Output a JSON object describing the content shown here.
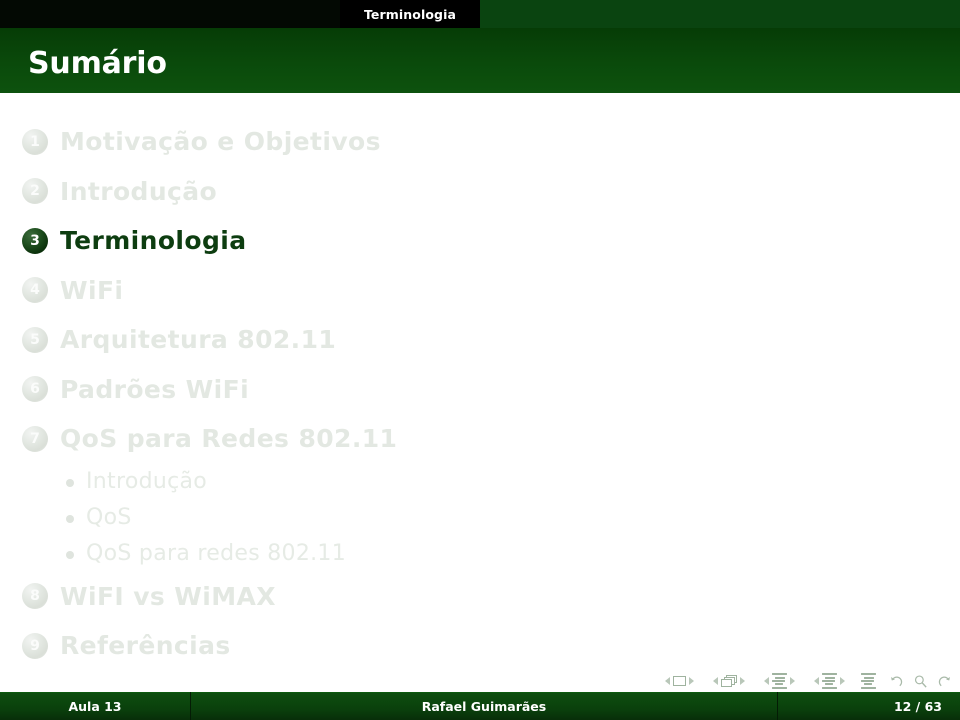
{
  "header": {
    "sections": [
      {
        "label": "",
        "active": false
      },
      {
        "label": "",
        "active": false
      },
      {
        "label": "Terminologia",
        "active": true
      },
      {
        "label": "",
        "active": false
      }
    ],
    "current_section": "Terminologia"
  },
  "title": {
    "text": "Sumário"
  },
  "toc": {
    "sections": [
      {
        "number": "1",
        "label": "Motivação e Objetivos",
        "active": false,
        "subitems": []
      },
      {
        "number": "2",
        "label": "Introdução",
        "active": false,
        "subitems": []
      },
      {
        "number": "3",
        "label": "Terminologia",
        "active": true,
        "subitems": []
      },
      {
        "number": "4",
        "label": "WiFi",
        "active": false,
        "subitems": []
      },
      {
        "number": "5",
        "label": "Arquitetura 802.11",
        "active": false,
        "subitems": []
      },
      {
        "number": "6",
        "label": "Padrões WiFi",
        "active": false,
        "subitems": []
      },
      {
        "number": "7",
        "label": "QoS para Redes 802.11",
        "active": false,
        "subitems": [
          "Introdução",
          "QoS",
          "QoS para redes 802.11"
        ]
      },
      {
        "number": "8",
        "label": "WiFI vs WiMAX",
        "active": false,
        "subitems": []
      },
      {
        "number": "9",
        "label": "Referências",
        "active": false,
        "subitems": []
      }
    ]
  },
  "navsymbols": {
    "items": [
      {
        "name": "slide-navigation",
        "icon": "slide-icon"
      },
      {
        "name": "frame-navigation",
        "icon": "frames-icon"
      },
      {
        "name": "subsection-navigation",
        "icon": "subsection-lines-icon"
      },
      {
        "name": "section-navigation",
        "icon": "section-lines-icon"
      },
      {
        "name": "document-navigation",
        "icon": "document-lines-icon"
      },
      {
        "name": "back-navigation",
        "icon": "back-arrow-icon"
      },
      {
        "name": "search-navigation",
        "icon": "search-icon"
      },
      {
        "name": "forward-navigation",
        "icon": "forward-arrow-icon"
      }
    ]
  },
  "footer": {
    "left": "Aula 13",
    "center": "Rafael Guimarães",
    "right": "12 / 63"
  },
  "colors": {
    "brand_green": "#0a4c0a",
    "title_green": "#064006",
    "active_text": "#0d3d10",
    "dim_text": "#e3e8e2",
    "header_tab_active": "#000000",
    "footer_green": "#0a400c"
  }
}
